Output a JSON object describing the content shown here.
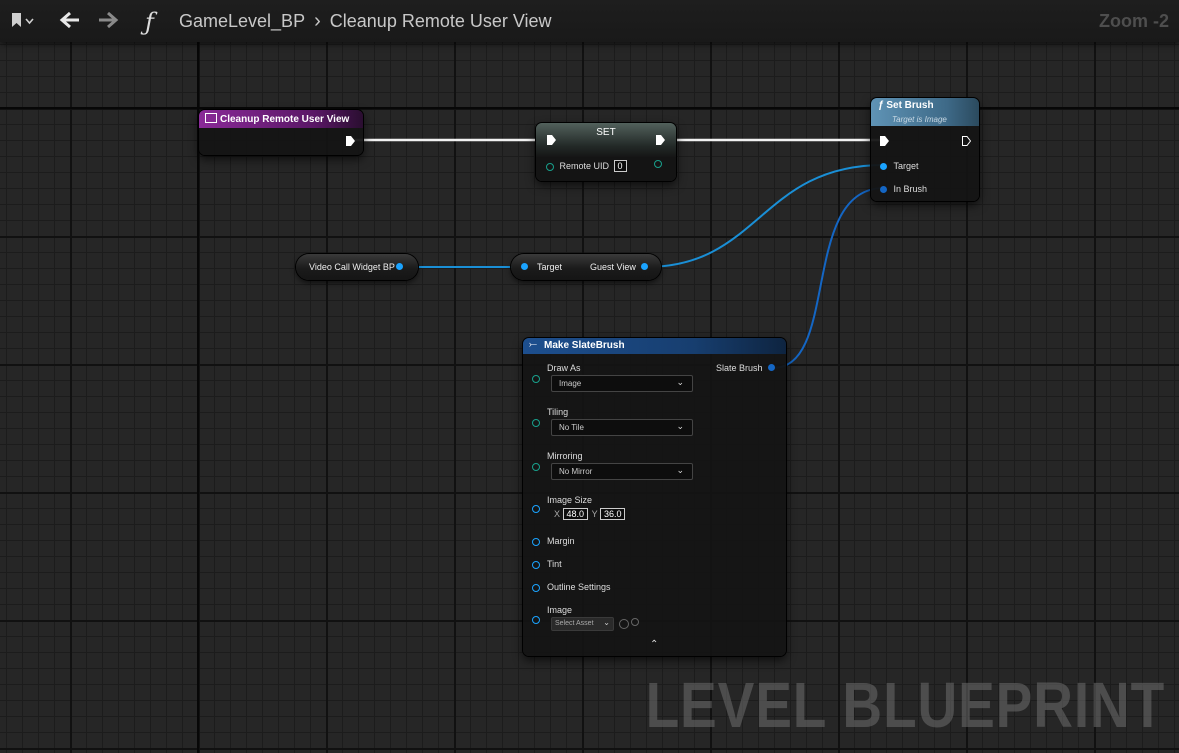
{
  "toolbar": {
    "bookmark_icon": "bookmark-icon",
    "back_icon": "arrow-left-icon",
    "forward_icon": "arrow-right-icon",
    "function_glyph": "ƒ",
    "breadcrumb_root": "GameLevel_BP",
    "breadcrumb_sep": "›",
    "breadcrumb_current": "Cleanup Remote User View",
    "zoom": "Zoom -2"
  },
  "watermark": "LEVEL BLUEPRINT",
  "colors": {
    "event_header": "#7a1e86",
    "set_header": "#4a5a55",
    "function_header": "#4f7fa0",
    "make_header": "#1b4a87",
    "object_pin": "#1aa3ff",
    "int_pin": "#18a08c"
  },
  "nodes": {
    "event": {
      "title": "Cleanup Remote User View"
    },
    "set": {
      "title": "SET",
      "pin_label": "Remote UID",
      "pin_value": "0"
    },
    "set_brush": {
      "title": "Set Brush",
      "subtitle": "Target is Image",
      "target_label": "Target",
      "in_brush_label": "In Brush"
    },
    "video_call": {
      "label": "Video Call Widget BP"
    },
    "guest_view": {
      "target_label": "Target",
      "output_label": "Guest View"
    },
    "make_brush": {
      "title": "Make SlateBrush",
      "output_label": "Slate Brush",
      "draw_as_label": "Draw As",
      "draw_as_value": "Image",
      "tiling_label": "Tiling",
      "tiling_value": "No Tile",
      "mirroring_label": "Mirroring",
      "mirroring_value": "No Mirror",
      "image_size_label": "Image Size",
      "image_size_x_label": "X",
      "image_size_x": "48.0",
      "image_size_y_label": "Y",
      "image_size_y": "36.0",
      "margin_label": "Margin",
      "tint_label": "Tint",
      "outline_label": "Outline Settings",
      "image_label": "Image",
      "image_value": "Select Asset"
    }
  }
}
